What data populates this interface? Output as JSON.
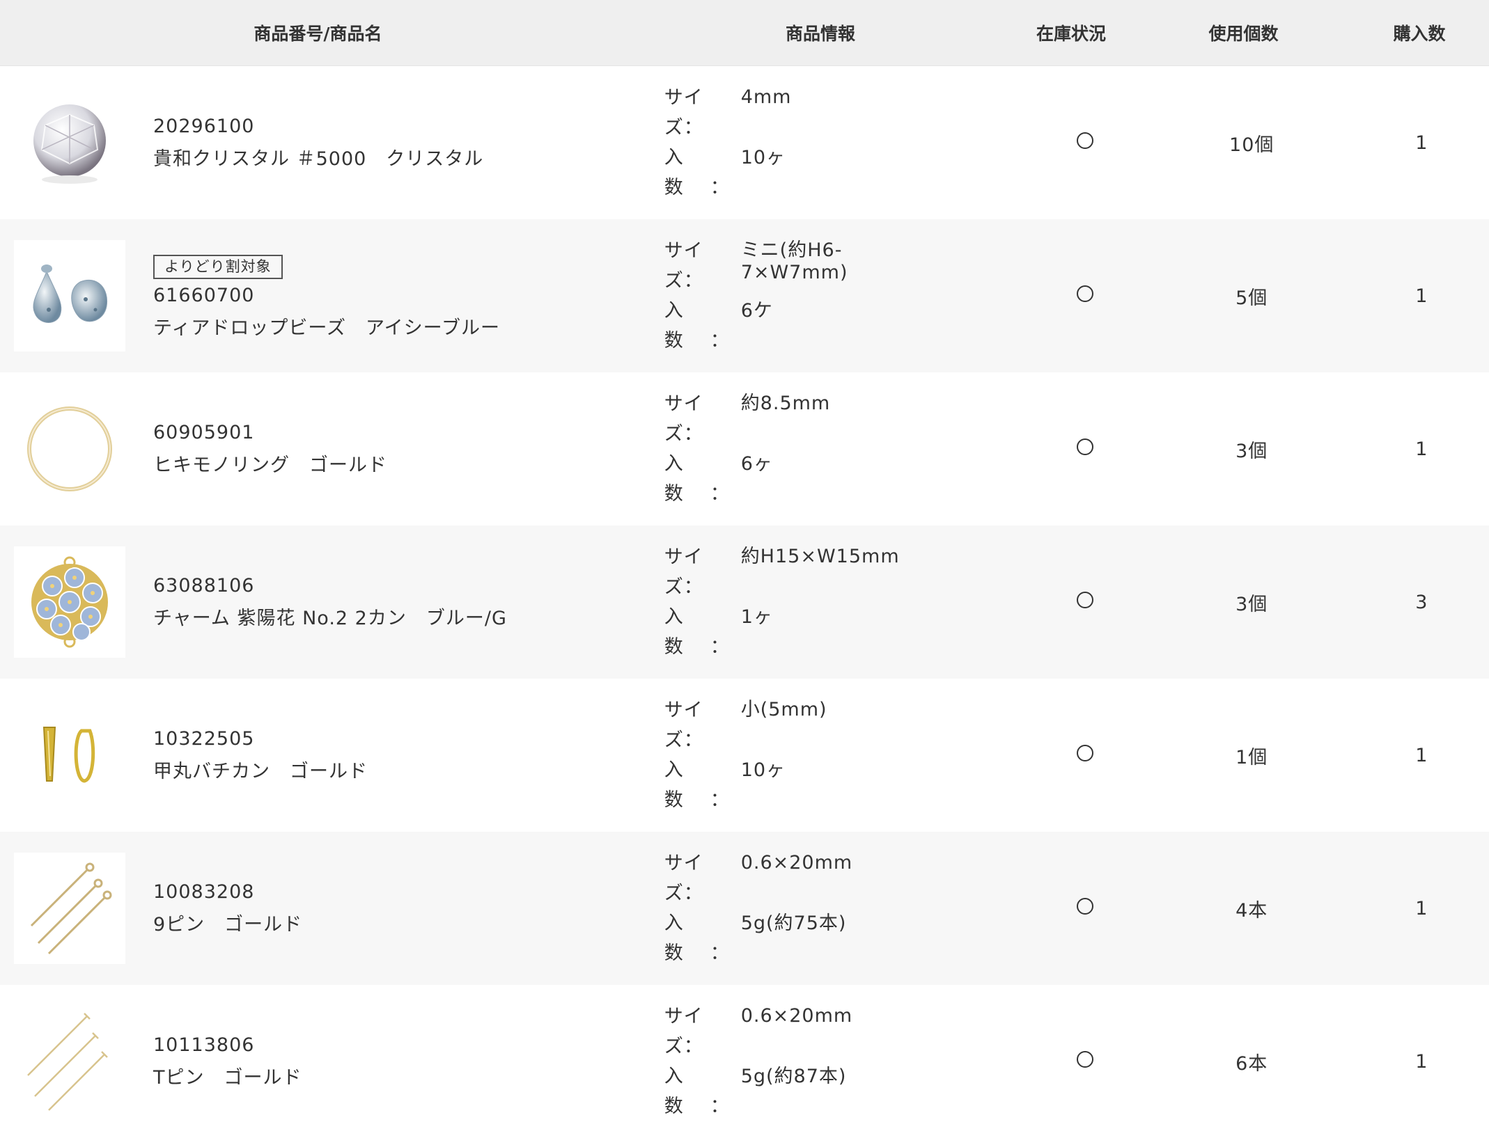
{
  "header": {
    "col_name": "商品番号/商品名",
    "col_info": "商品情報",
    "col_stock": "在庫状況",
    "col_use": "使用個数",
    "col_qty": "購入数"
  },
  "info_labels": {
    "size": "サイズ",
    "count": "入数",
    "sep": "："
  },
  "items": [
    {
      "code": "20296100",
      "name": "貴和クリスタル ＃5000　クリスタル",
      "tag": "",
      "size": "4mm",
      "count": "10ヶ",
      "stock": "〇",
      "use": "10個",
      "qty": "1",
      "icon": "crystal-bead-icon"
    },
    {
      "code": "61660700",
      "name": "ティアドロップビーズ　アイシーブルー",
      "tag": "よりどり割対象",
      "size": "ミニ(約H6-7×W7mm)",
      "count": "6ケ",
      "stock": "〇",
      "use": "5個",
      "qty": "1",
      "icon": "teardrop-bead-icon"
    },
    {
      "code": "60905901",
      "name": "ヒキモノリング　ゴールド",
      "tag": "",
      "size": "約8.5mm",
      "count": "6ヶ",
      "stock": "〇",
      "use": "3個",
      "qty": "1",
      "icon": "ring-icon"
    },
    {
      "code": "63088106",
      "name": "チャーム 紫陽花 No.2 2カン　ブルー/G",
      "tag": "",
      "size": "約H15×W15mm",
      "count": "1ヶ",
      "stock": "〇",
      "use": "3個",
      "qty": "3",
      "icon": "hydrangea-charm-icon"
    },
    {
      "code": "10322505",
      "name": "甲丸バチカン　ゴールド",
      "tag": "",
      "size": "小(5mm)",
      "count": "10ヶ",
      "stock": "〇",
      "use": "1個",
      "qty": "1",
      "icon": "bail-icon"
    },
    {
      "code": "10083208",
      "name": "9ピン　ゴールド",
      "tag": "",
      "size": "0.6×20mm",
      "count": "5g(約75本)",
      "stock": "〇",
      "use": "4本",
      "qty": "1",
      "icon": "eye-pin-icon"
    },
    {
      "code": "10113806",
      "name": "Tピン　ゴールド",
      "tag": "",
      "size": "0.6×20mm",
      "count": "5g(約87本)",
      "stock": "〇",
      "use": "6本",
      "qty": "1",
      "icon": "t-pin-icon"
    }
  ]
}
